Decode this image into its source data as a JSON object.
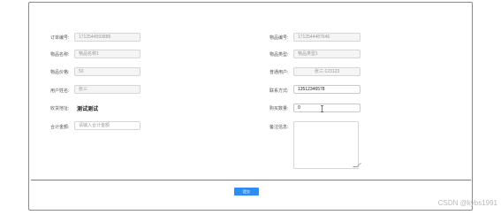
{
  "left_fields": {
    "order_no": {
      "label": "订单编号:",
      "value": "1712544593888"
    },
    "item_name": {
      "label": "物品名称:",
      "value": "物品名称1"
    },
    "item_price": {
      "label": "物品价格:",
      "value": "50"
    },
    "user_name": {
      "label": "用户姓名:",
      "value": "张三"
    },
    "address": {
      "label": "收货地址:",
      "value": "测试测试"
    },
    "total_amount": {
      "label": "合计金额:",
      "placeholder": "请输入合计金额"
    }
  },
  "right_fields": {
    "item_no": {
      "label": "物品编号:",
      "value": "1712544487646"
    },
    "item_type": {
      "label": "物品类型:",
      "value": "物品类型1"
    },
    "regular_user": {
      "label": "普通用户:",
      "value": "张三-123123"
    },
    "contact": {
      "label": "联系方式:",
      "value": "13512346578"
    },
    "quantity": {
      "label": "购买数量:",
      "value": "0"
    },
    "remarks": {
      "label": "备注信息:"
    }
  },
  "actions": {
    "submit_label": "提交"
  },
  "watermark": "CSDN @kybs1991",
  "colors": {
    "accent": "#2f8cf0",
    "divider": "#3d8fdc"
  }
}
